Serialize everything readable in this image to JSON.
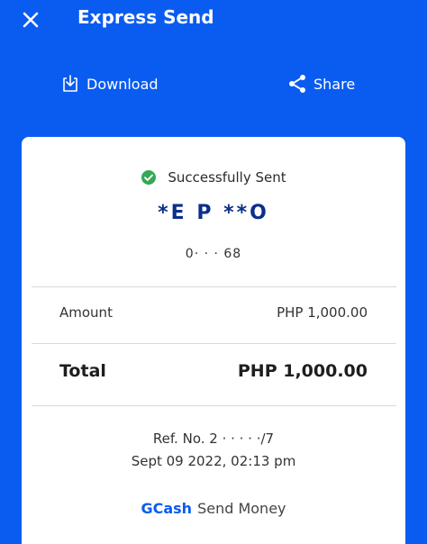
{
  "header": {
    "title": "Express Send"
  },
  "actions": {
    "download_label": "Download",
    "share_label": "Share"
  },
  "receipt": {
    "status": "Successfully Sent",
    "recipient_name": "*E P   **O",
    "recipient_number": "0·  ·   ·  68",
    "amount_label": "Amount",
    "amount_value": "PHP 1,000.00",
    "total_label": "Total",
    "total_value": "PHP 1,000.00",
    "ref_no": "Ref. No. 2 ·  ·   ·    ·  ·/7",
    "datetime": "Sept 09 2022, 02:13 pm",
    "brand_name": "GCash",
    "service": "Send Money"
  },
  "icons": {
    "close": "close-icon",
    "download": "download-icon",
    "share": "share-icon",
    "success": "check-circle-icon"
  },
  "colors": {
    "background": "#0a5cf0",
    "recipient": "#0b2f8a",
    "success": "#34a853",
    "brand": "#0a5cf0"
  }
}
